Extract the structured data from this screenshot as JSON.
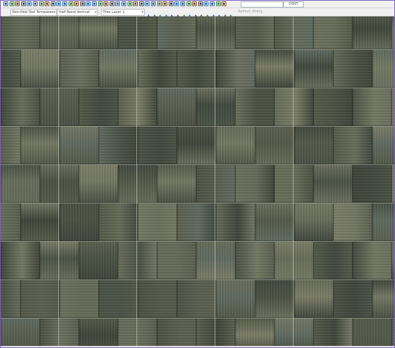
{
  "toolbar": {
    "row1_icons": [
      "save-icon",
      "open-icon",
      "undo-icon",
      "redo-icon",
      "arc-icon",
      "triangle-icon",
      "cut-icon",
      "pointer-icon",
      "select-box-icon",
      "copy-icon",
      "paste-icon",
      "pen-icon",
      "camera-icon",
      "dimension-icon",
      "envelope-icon",
      "cloud-icon",
      "chevron-icon",
      "align-icon",
      "square-icon",
      "polygon-icon",
      "measure-icon",
      "scale-icon",
      "rotate-icon",
      "mirror-icon",
      "grid-icon",
      "circle-icon",
      "circle-2-icon",
      "house-icon",
      "book-icon",
      "layers-icon",
      "group-icon",
      "shield-icon",
      "globe-icon",
      "info-icon",
      "zoom-icon",
      "refresh-icon",
      "pin-icon",
      "link-icon"
    ],
    "search_count": "OSNT",
    "row2_icons": [
      "edit-icon",
      "snap-icon",
      "edge-icon",
      "corner-icon",
      "grid-snap-icon",
      "stack-icon",
      "chart-icon",
      "table-icon",
      "wall-icon",
      "arrow-icon",
      "angle-icon",
      "measure-2-icon",
      "palette-icon",
      "lock-icon",
      "flag-icon"
    ]
  },
  "dropdowns": {
    "template": "Non-Paid Tool Templates",
    "bond": "Half Bond Vertical",
    "layer": "Tiles Layer 1"
  },
  "auto_field": "Refresh Vising",
  "colors": {
    "frame": "#7b5fc0",
    "tile_palette": [
      "#4b5143",
      "#5a5f4f",
      "#6b6f5d",
      "#3f4539",
      "#737863",
      "#545a48",
      "#656b58",
      "#4a5245",
      "#5f6a5f",
      "#7a7c66",
      "#41483d",
      "#686d5a"
    ]
  }
}
